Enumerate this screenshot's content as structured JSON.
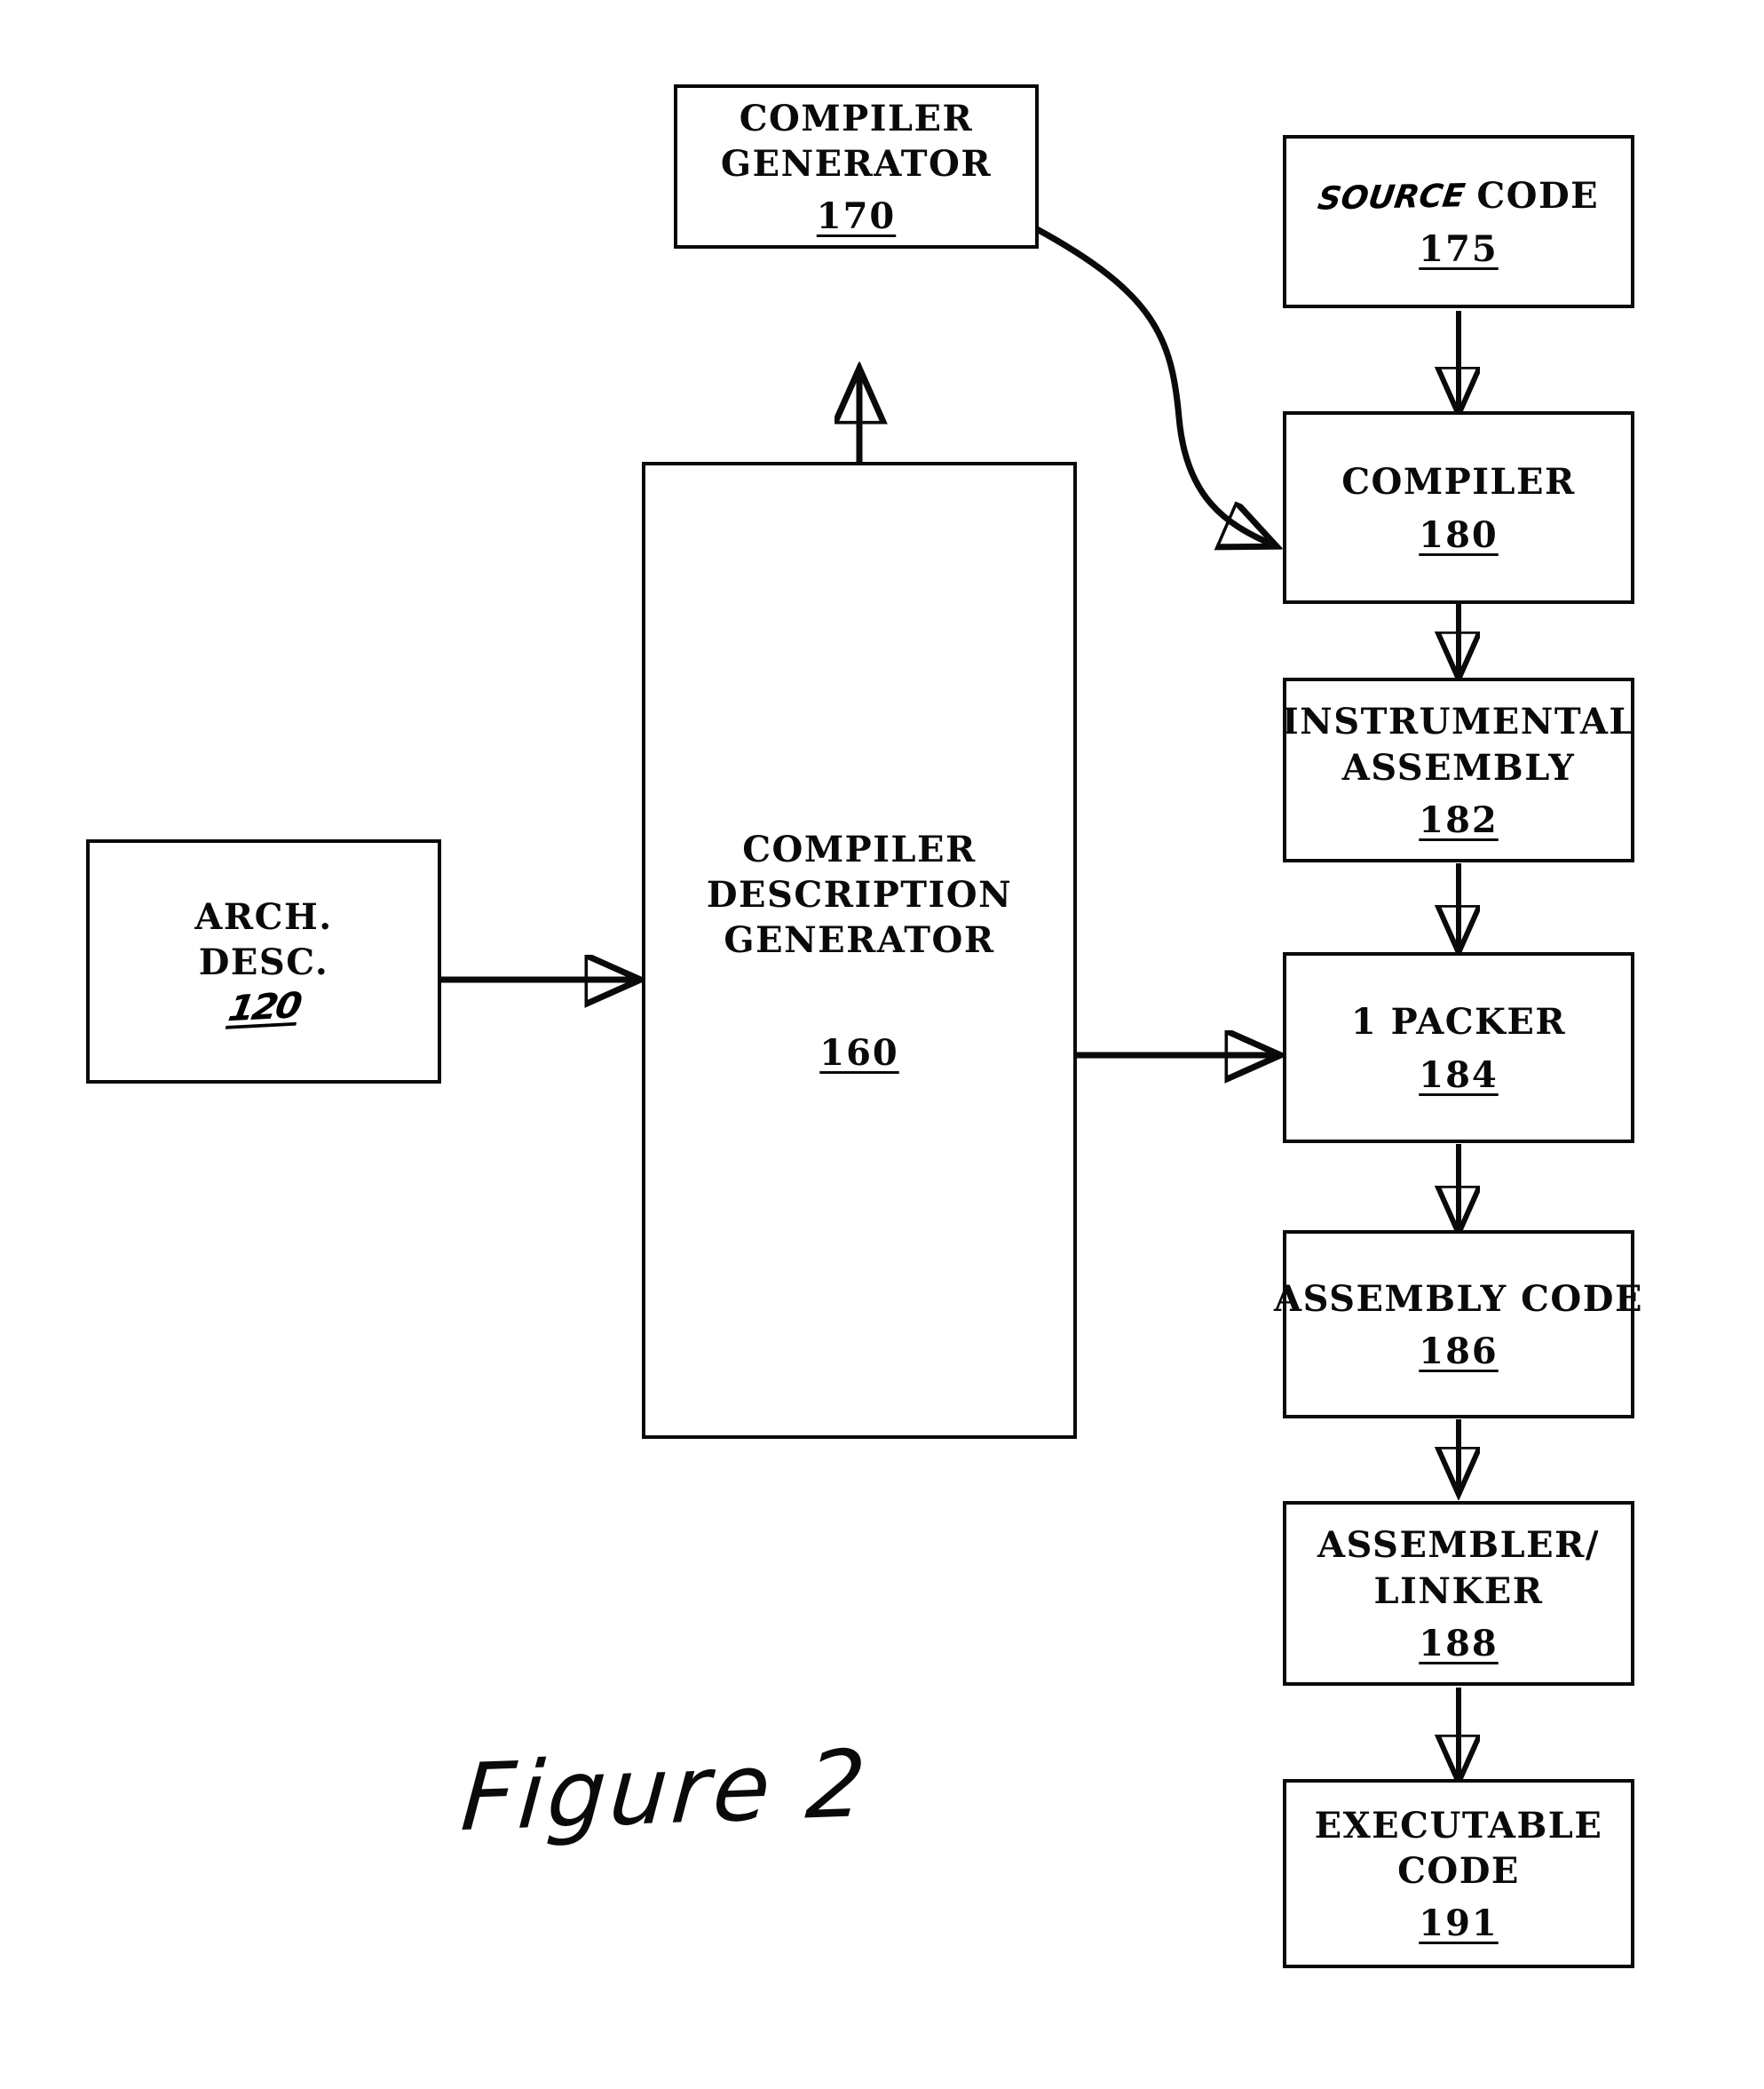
{
  "figure": {
    "caption": "Figure 2"
  },
  "nodes": {
    "compiler_generator": {
      "line1": "COMPILER",
      "line2": "GENERATOR",
      "ref": "170"
    },
    "source_code": {
      "handwritten_word": "SOURCE",
      "line1": "CODE",
      "ref": "175"
    },
    "compiler": {
      "line1": "COMPILER",
      "ref": "180"
    },
    "instrumental_assembly": {
      "line1": "INSTRUMENTAL",
      "line2": "ASSEMBLY",
      "ref": "182"
    },
    "packer": {
      "line1": "1 PACKER",
      "ref": "184"
    },
    "assembly_code": {
      "line1": "ASSEMBLY CODE",
      "ref": "186"
    },
    "assembler_linker": {
      "line1": "ASSEMBLER/",
      "line2": "LINKER",
      "ref": "188"
    },
    "executable_code": {
      "line1": "EXECUTABLE",
      "line2": "CODE",
      "ref": "191"
    },
    "arch_desc": {
      "line1": "ARCH.",
      "line2": "DESC.",
      "ref": "120"
    },
    "compiler_description_generator": {
      "line1": "COMPILER",
      "line2": "DESCRIPTION",
      "line3": "GENERATOR",
      "ref": "160"
    }
  },
  "connectors": [
    {
      "name": "source-code-to-compiler",
      "kind": "arrow-down"
    },
    {
      "name": "compiler-to-instrumental-assembly",
      "kind": "arrow-down"
    },
    {
      "name": "instrumental-assembly-to-packer",
      "kind": "arrow-down"
    },
    {
      "name": "packer-to-assembly-code",
      "kind": "arrow-down"
    },
    {
      "name": "assembly-code-to-assembler-linker",
      "kind": "arrow-down"
    },
    {
      "name": "assembler-linker-to-executable-code",
      "kind": "arrow-down"
    },
    {
      "name": "arch-desc-to-compiler-description-generator",
      "kind": "arrow-right"
    },
    {
      "name": "compiler-description-generator-to-packer",
      "kind": "arrow-right"
    },
    {
      "name": "compiler-description-generator-to-compiler-generator",
      "kind": "arrow-up"
    },
    {
      "name": "compiler-generator-to-compiler",
      "kind": "curved-arrow"
    }
  ]
}
